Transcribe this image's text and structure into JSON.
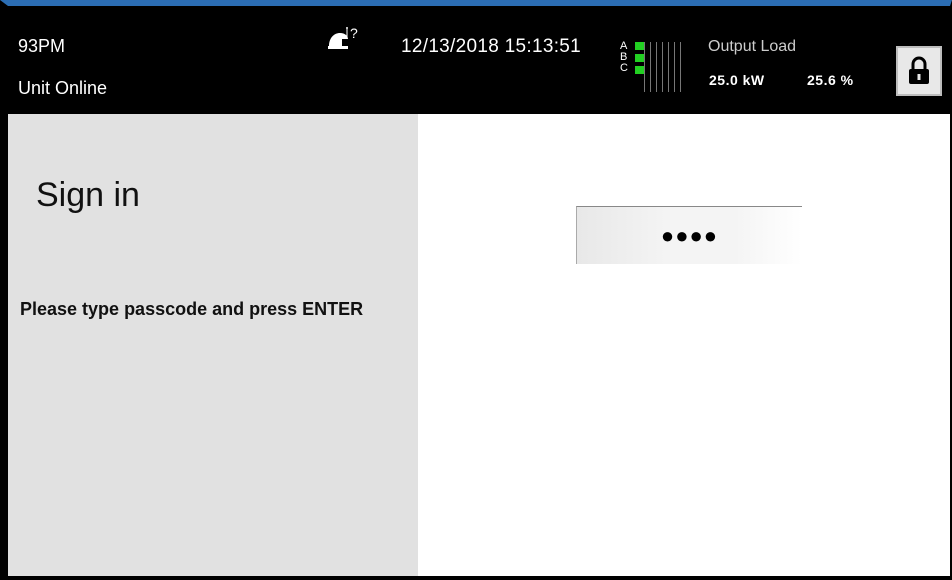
{
  "header": {
    "unit_id": "93PM",
    "unit_status": "Unit Online",
    "datetime": "12/13/2018 15:13:51",
    "phases": [
      "A",
      "B",
      "C"
    ],
    "output_load": {
      "title": "Output Load",
      "kw": "25.0 kW",
      "percent": "25.6 %"
    },
    "icons": {
      "help": "help-icon",
      "lock": "lock-icon"
    },
    "colors": {
      "phase_ok": "#22d022"
    }
  },
  "signin": {
    "title": "Sign in",
    "instructions": "Please type passcode and press ENTER",
    "passcode_value": "●●●●"
  }
}
